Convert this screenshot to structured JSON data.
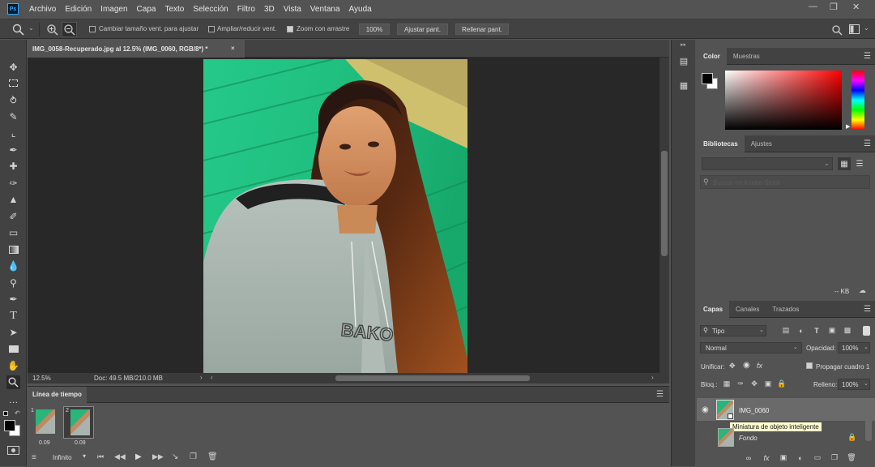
{
  "app": {
    "logo": "Ps"
  },
  "menu": [
    "Archivo",
    "Edición",
    "Imagen",
    "Capa",
    "Texto",
    "Selección",
    "Filtro",
    "3D",
    "Vista",
    "Ventana",
    "Ayuda"
  ],
  "options_bar": {
    "resize_windows_label": "Cambiar tamaño vent. para ajustar",
    "zoom_all_label": "Ampliar/reducir vent.",
    "scrubby_zoom_label": "Zoom con arrastre",
    "zoom_100_label": "100%",
    "fit_screen_label": "Ajustar pant.",
    "fill_screen_label": "Rellenar pant."
  },
  "document": {
    "tab_title": "IMG_0058-Recuperado.jpg al 12.5% (IMG_0060, RGB/8*) *",
    "zoom_level": "12.5%",
    "doc_info": "Doc: 49.5 MB/210.0 MB",
    "photo_text": "BAKO"
  },
  "timeline": {
    "title": "Línea de tiempo",
    "frames": [
      {
        "number": "1",
        "delay": "0.09"
      },
      {
        "number": "2",
        "delay": "0.09"
      }
    ],
    "loop": "Infinito"
  },
  "color_panel": {
    "tabs": [
      "Color",
      "Muestras"
    ],
    "colors": {
      "hue_base": "#ff0000",
      "foreground": "#000000",
      "background": "#ffffff"
    }
  },
  "libraries_panel": {
    "tabs": [
      "Bibliotecas",
      "Ajustes"
    ],
    "search_placeholder": "Buscar en Adobe Stock",
    "size": "-- KB"
  },
  "layers_panel": {
    "tabs": [
      "Capas",
      "Canales",
      "Trazados"
    ],
    "kind_filter": "Tipo",
    "blend_mode": "Normal",
    "opacity_label": "Opacidad:",
    "opacity_value": "100%",
    "unify_label": "Unificar:",
    "propagate_label": "Propagar cuadro 1",
    "lock_label": "Bloq.:",
    "fill_label": "Relleno:",
    "fill_value": "100%",
    "layers": [
      {
        "name": "IMG_0060",
        "selected": true
      },
      {
        "name": "Fondo",
        "selected": false
      }
    ],
    "tooltip": "Miniatura de objeto inteligente"
  }
}
